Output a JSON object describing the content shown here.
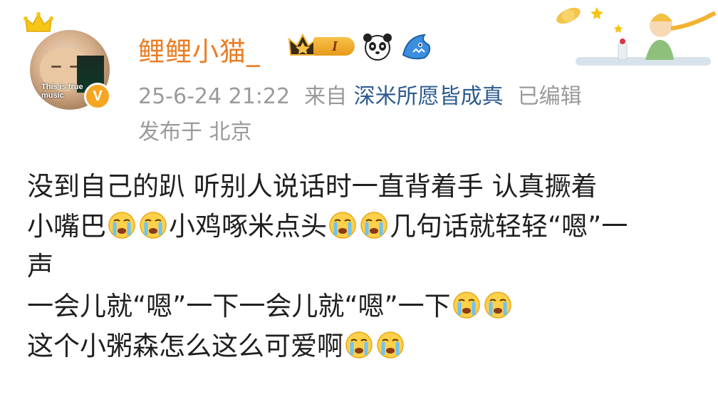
{
  "post": {
    "username": "鲤鲤小猫_",
    "level": "I",
    "time": "25-6-24 21:22",
    "from_prefix": "来自",
    "source": "深米所愿皆成真",
    "edited": "已编辑",
    "location": "发布于 北京",
    "avatar_caption_1": "This is true",
    "avatar_caption_2": "music",
    "verified_mark": "V"
  },
  "body": {
    "line1": "没到自己的趴 听别人说话时一直背着手 认真撅着",
    "line2_a": "小嘴巴",
    "line2_b": "小鸡啄米点头",
    "line2_c": "几句话就轻轻“嗯”一",
    "line3": "声",
    "line4": "一会儿就“嗯”一下一会儿就“嗯”一下",
    "line5": "这个小粥森怎么这么可爱啊"
  },
  "colors": {
    "username": "#ea7d24",
    "meta": "#9a9a9a",
    "source_link": "#2c5b8f",
    "text": "#1f1f1f",
    "verified_badge": "#f5a623"
  },
  "icons": [
    "crown-icon",
    "level-crown-icon",
    "panda-icon",
    "shark-icon",
    "crying-face-emoji",
    "verified-badge-icon"
  ]
}
